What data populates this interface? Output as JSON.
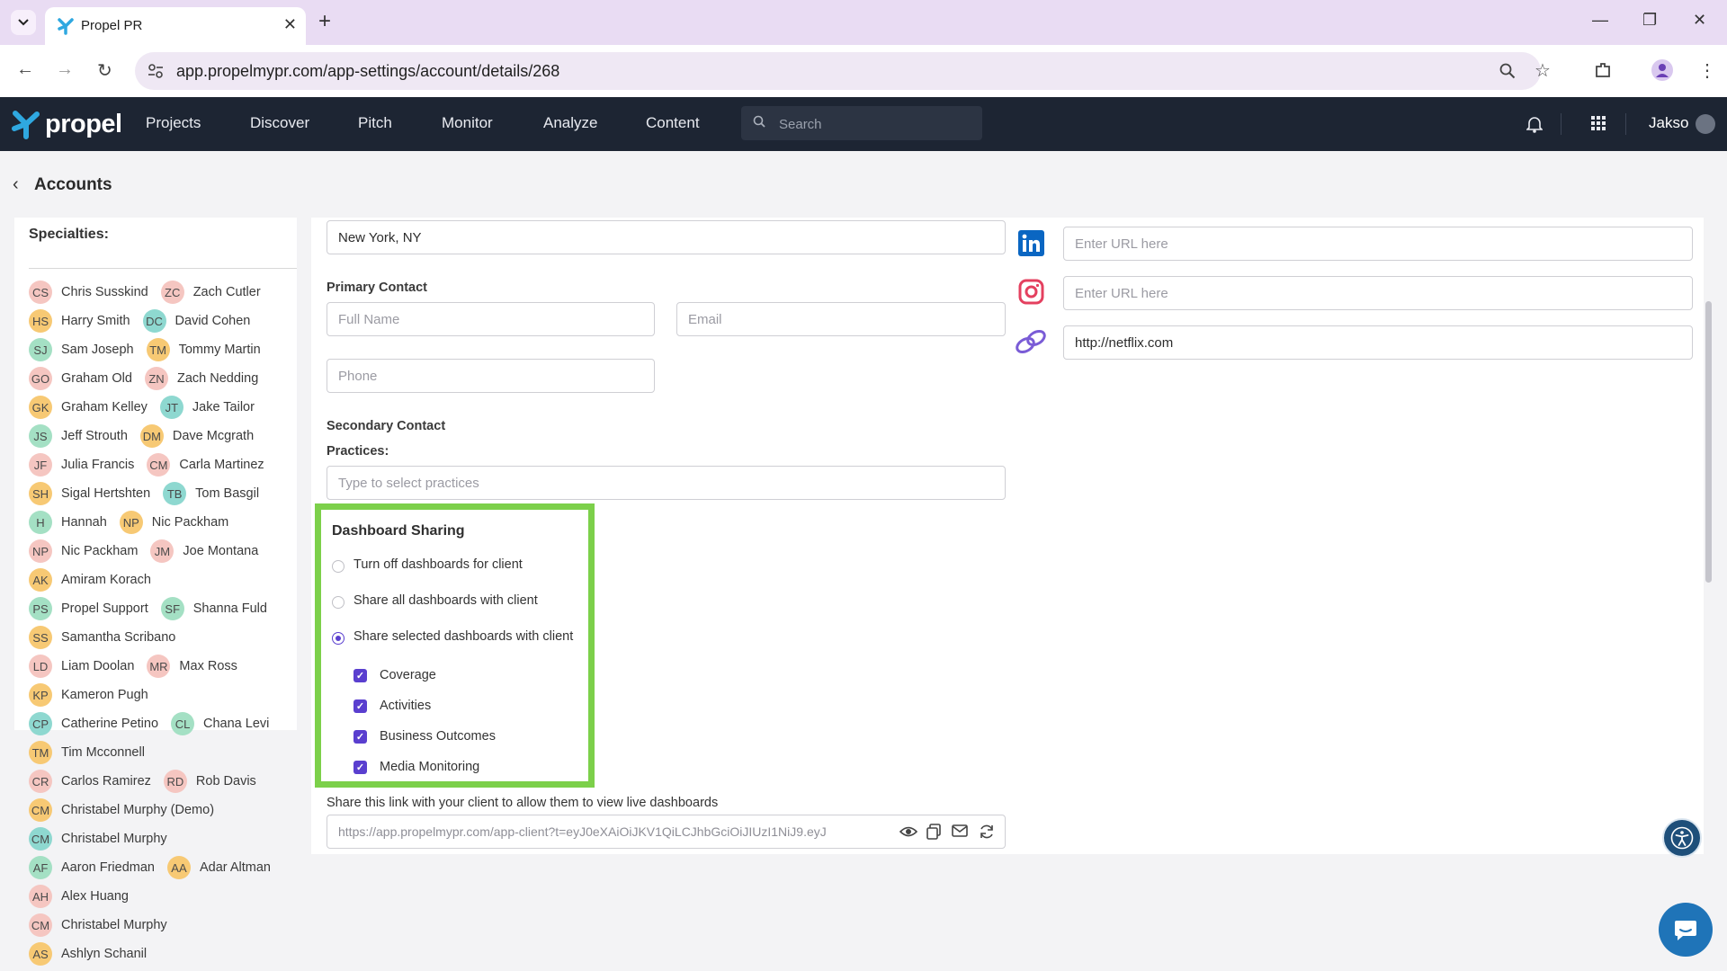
{
  "browser": {
    "tab_title": "Propel PR",
    "url": "app.propelmypr.com/app-settings/account/details/268"
  },
  "app": {
    "logo_text": "propel",
    "nav": [
      "Projects",
      "Discover",
      "Pitch",
      "Monitor",
      "Analyze",
      "Content"
    ],
    "search_placeholder": "Search",
    "user_name": "Jakso"
  },
  "page": {
    "back_label": "Accounts",
    "specialties_label": "Specialties:"
  },
  "members": [
    [
      {
        "i": "CS",
        "n": "Chris Susskind",
        "c": "red"
      },
      {
        "i": "ZC",
        "n": "Zach Cutler",
        "c": "red"
      }
    ],
    [
      {
        "i": "HS",
        "n": "Harry Smith",
        "c": "yel"
      },
      {
        "i": "DC",
        "n": "David Cohen",
        "c": "teal"
      }
    ],
    [
      {
        "i": "SJ",
        "n": "Sam Joseph",
        "c": "grn"
      },
      {
        "i": "TM",
        "n": "Tommy Martin",
        "c": "yel"
      }
    ],
    [
      {
        "i": "GO",
        "n": "Graham Old",
        "c": "red"
      },
      {
        "i": "ZN",
        "n": "Zach Nedding",
        "c": "red"
      }
    ],
    [
      {
        "i": "GK",
        "n": "Graham Kelley",
        "c": "yel"
      },
      {
        "i": "JT",
        "n": "Jake Tailor",
        "c": "teal"
      }
    ],
    [
      {
        "i": "JS",
        "n": "Jeff Strouth",
        "c": "grn"
      },
      {
        "i": "DM",
        "n": "Dave Mcgrath",
        "c": "yel"
      }
    ],
    [
      {
        "i": "JF",
        "n": "Julia Francis",
        "c": "red"
      },
      {
        "i": "CM",
        "n": "Carla Martinez",
        "c": "red"
      }
    ],
    [
      {
        "i": "SH",
        "n": "Sigal Hertshten",
        "c": "yel"
      },
      {
        "i": "TB",
        "n": "Tom Basgil",
        "c": "teal"
      }
    ],
    [
      {
        "i": "H",
        "n": "Hannah",
        "c": "grn"
      },
      {
        "i": "NP",
        "n": "Nic Packham",
        "c": "yel"
      }
    ],
    [
      {
        "i": "NP",
        "n": "Nic Packham",
        "c": "red"
      },
      {
        "i": "JM",
        "n": "Joe Montana",
        "c": "red"
      }
    ],
    [
      {
        "i": "AK",
        "n": "Amiram Korach",
        "c": "yel"
      }
    ],
    [
      {
        "i": "PS",
        "n": "Propel Support",
        "c": "grn"
      },
      {
        "i": "SF",
        "n": "Shanna Fuld",
        "c": "grn"
      }
    ],
    [
      {
        "i": "SS",
        "n": "Samantha Scribano",
        "c": "yel"
      }
    ],
    [
      {
        "i": "LD",
        "n": "Liam Doolan",
        "c": "red"
      },
      {
        "i": "MR",
        "n": "Max Ross",
        "c": "red"
      }
    ],
    [
      {
        "i": "KP",
        "n": "Kameron Pugh",
        "c": "yel"
      }
    ],
    [
      {
        "i": "CP",
        "n": "Catherine Petino",
        "c": "teal"
      },
      {
        "i": "CL",
        "n": "Chana Levi",
        "c": "grn"
      }
    ],
    [
      {
        "i": "TM",
        "n": "Tim Mcconnell",
        "c": "yel"
      }
    ],
    [
      {
        "i": "CR",
        "n": "Carlos Ramirez",
        "c": "red"
      },
      {
        "i": "RD",
        "n": "Rob Davis",
        "c": "red"
      }
    ],
    [
      {
        "i": "CM",
        "n": "Christabel Murphy (Demo)",
        "c": "yel"
      }
    ],
    [
      {
        "i": "CM",
        "n": "Christabel Murphy",
        "c": "teal"
      }
    ],
    [
      {
        "i": "AF",
        "n": "Aaron Friedman",
        "c": "grn"
      },
      {
        "i": "AA",
        "n": "Adar Altman",
        "c": "yel"
      }
    ],
    [
      {
        "i": "AH",
        "n": "Alex Huang",
        "c": "red"
      }
    ],
    [
      {
        "i": "CM",
        "n": "Christabel Murphy",
        "c": "red"
      }
    ],
    [
      {
        "i": "AS",
        "n": "Ashlyn Schanil",
        "c": "yel"
      }
    ]
  ],
  "form": {
    "location_value": "New York, NY",
    "primary_contact_label": "Primary Contact",
    "full_name_placeholder": "Full Name",
    "email_placeholder": "Email",
    "phone_placeholder": "Phone",
    "secondary_contact_label": "Secondary Contact",
    "practices_label": "Practices:",
    "practices_placeholder": "Type to select practices",
    "linkedin_placeholder": "Enter URL here",
    "instagram_placeholder": "Enter URL here",
    "website_value": "http://netflix.com"
  },
  "dashboard_sharing": {
    "title": "Dashboard Sharing",
    "options": [
      {
        "label": "Turn off dashboards for client",
        "selected": false
      },
      {
        "label": "Share all dashboards with client",
        "selected": false
      },
      {
        "label": "Share selected dashboards with client",
        "selected": true
      }
    ],
    "dashboards": [
      {
        "label": "Coverage",
        "checked": true
      },
      {
        "label": "Activities",
        "checked": true
      },
      {
        "label": "Business Outcomes",
        "checked": true
      },
      {
        "label": "Media Monitoring",
        "checked": true
      }
    ],
    "share_link_label": "Share this link with your client to allow them to view live dashboards",
    "share_link": "https://app.propelmypr.com/app-client?t=eyJ0eXAiOiJKV1QiLCJhbGciOiJIUzI1NiJ9.eyJ"
  },
  "icons": {
    "accent": "#5a3fcf",
    "highlight": "#7cd04a",
    "header_bg": "#1d2533"
  }
}
